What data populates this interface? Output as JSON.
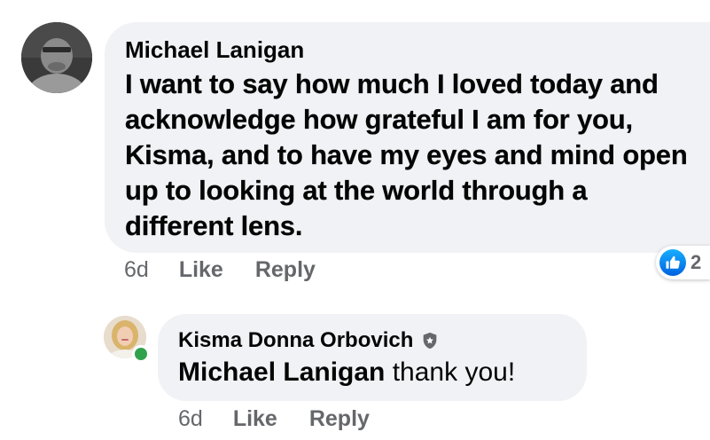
{
  "main_comment": {
    "author": "Michael Lanigan",
    "text": "I want to say how much I loved today and acknowledge how grateful I am for you, Kisma, and to have my eyes and mind open up to looking at the world through a different lens.",
    "time": "6d",
    "like_label": "Like",
    "reply_label": "Reply",
    "reaction_icon": "like-thumb-icon",
    "reaction_count": "2",
    "bubble_color": "#f0f2f5",
    "like_color": "#1877f2"
  },
  "reply_comment": {
    "author": "Kisma Donna Orbovich",
    "badge_icon": "shield-icon",
    "mention": "Michael Lanigan",
    "text": " thank you!",
    "time": "6d",
    "like_label": "Like",
    "reply_label": "Reply",
    "online_status_color": "#31a24c"
  }
}
